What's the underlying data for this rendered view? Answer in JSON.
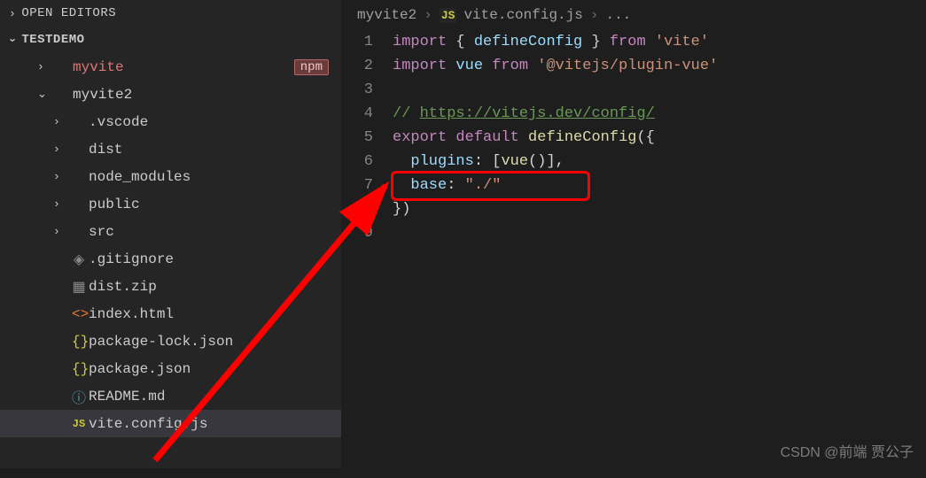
{
  "sidebar": {
    "open_editors_label": "OPEN EDITORS",
    "root_label": "TESTDEMO",
    "npm_badge": "npm",
    "items": [
      {
        "label": "myvite",
        "type": "folder",
        "expanded": false,
        "color": "red"
      },
      {
        "label": "myvite2",
        "type": "folder",
        "expanded": true
      },
      {
        "label": ".vscode",
        "type": "folder",
        "expanded": false
      },
      {
        "label": "dist",
        "type": "folder",
        "expanded": false
      },
      {
        "label": "node_modules",
        "type": "folder",
        "expanded": false
      },
      {
        "label": "public",
        "type": "folder",
        "expanded": false
      },
      {
        "label": "src",
        "type": "folder",
        "expanded": false
      },
      {
        "label": ".gitignore",
        "type": "file",
        "icon": "gitignore"
      },
      {
        "label": "dist.zip",
        "type": "file",
        "icon": "zip"
      },
      {
        "label": "index.html",
        "type": "file",
        "icon": "html"
      },
      {
        "label": "package-lock.json",
        "type": "file",
        "icon": "json"
      },
      {
        "label": "package.json",
        "type": "file",
        "icon": "json"
      },
      {
        "label": "README.md",
        "type": "file",
        "icon": "info"
      },
      {
        "label": "vite.config.js",
        "type": "file",
        "icon": "js",
        "selected": true
      }
    ]
  },
  "breadcrumbs": {
    "parts": [
      "myvite2",
      "vite.config.js",
      "..."
    ],
    "js_tag": "JS"
  },
  "code": {
    "lines": [
      {
        "n": 1,
        "tokens": [
          [
            "kw",
            "import "
          ],
          [
            "pun",
            "{ "
          ],
          [
            "id",
            "defineConfig"
          ],
          [
            "pun",
            " } "
          ],
          [
            "kw",
            "from "
          ],
          [
            "str",
            "'vite'"
          ]
        ]
      },
      {
        "n": 2,
        "tokens": [
          [
            "kw",
            "import "
          ],
          [
            "id",
            "vue"
          ],
          [
            "pun",
            " "
          ],
          [
            "kw",
            "from "
          ],
          [
            "str",
            "'@vitejs/plugin-vue'"
          ]
        ]
      },
      {
        "n": 3,
        "tokens": []
      },
      {
        "n": 4,
        "tokens": [
          [
            "cmt",
            "// "
          ],
          [
            "link",
            "https://vitejs.dev/config/"
          ]
        ]
      },
      {
        "n": 5,
        "tokens": [
          [
            "kw",
            "export "
          ],
          [
            "kw",
            "default "
          ],
          [
            "fn",
            "defineConfig"
          ],
          [
            "pun",
            "({"
          ]
        ]
      },
      {
        "n": 6,
        "tokens": [
          [
            "pun",
            "  "
          ],
          [
            "id",
            "plugins"
          ],
          [
            "pun",
            ": ["
          ],
          [
            "fn",
            "vue"
          ],
          [
            "pun",
            "()],"
          ]
        ]
      },
      {
        "n": 7,
        "tokens": [
          [
            "pun",
            "  "
          ],
          [
            "id",
            "base"
          ],
          [
            "pun",
            ": "
          ],
          [
            "str",
            "\"./\""
          ]
        ]
      },
      {
        "n": 8,
        "tokens": [
          [
            "pun",
            "})"
          ]
        ]
      },
      {
        "n": 9,
        "tokens": []
      }
    ]
  },
  "watermark": "CSDN @前端 贾公子"
}
